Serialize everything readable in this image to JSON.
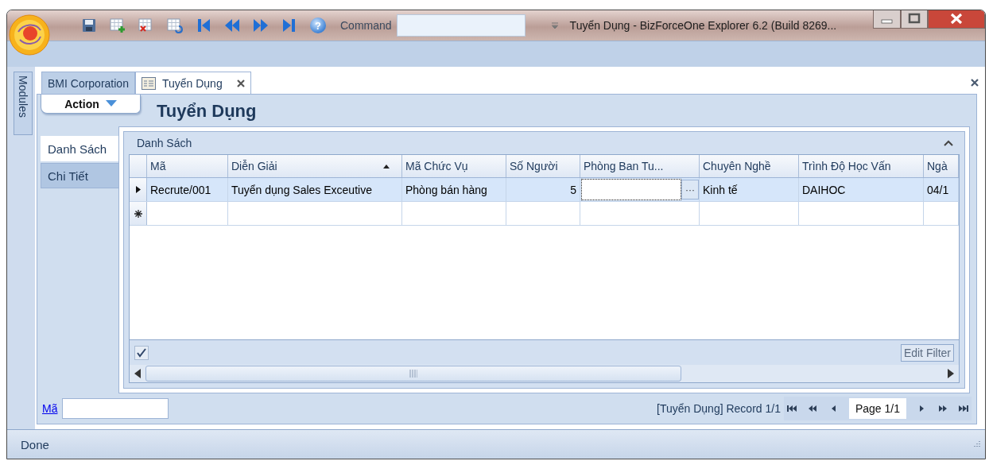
{
  "title_bar": {
    "help": "?",
    "command_label": "Command",
    "title": "Tuyển Dụng - BizForceOne Explorer 6.2 (Build 8269..."
  },
  "side_panel": {
    "label": "Modules"
  },
  "doc_tabs": [
    {
      "label": "BMI Corporation",
      "selected": false,
      "closable": false
    },
    {
      "label": "Tuyển Dụng",
      "selected": true,
      "closable": true
    }
  ],
  "action_menu": {
    "label": "Action"
  },
  "page_title": "Tuyển Dụng",
  "view_tabs": [
    {
      "label": "Danh Sách",
      "selected": true
    },
    {
      "label": "Chi Tiết",
      "selected": false
    }
  ],
  "grid": {
    "title": "Danh Sách",
    "columns": [
      {
        "label": "Mã",
        "sorted_ascending": false
      },
      {
        "label": "Diễn Giải",
        "sorted_ascending": true
      },
      {
        "label": "Mã Chức Vụ",
        "sorted_ascending": false
      },
      {
        "label": "Số Người",
        "sorted_ascending": false
      },
      {
        "label": "Phòng Ban Tu...",
        "sorted_ascending": false
      },
      {
        "label": "Chuyên Nghề",
        "sorted_ascending": false
      },
      {
        "label": "Trình Độ Học Vấn",
        "sorted_ascending": false
      },
      {
        "label": "Ngà",
        "sorted_ascending": false
      }
    ],
    "rows": [
      {
        "kind": "data",
        "current": true,
        "cells": [
          {
            "kind": "text",
            "text": "Recrute/001"
          },
          {
            "kind": "text",
            "text": "Tuyển dụng Sales Exceutive"
          },
          {
            "kind": "text",
            "text": "Phòng bán hàng"
          },
          {
            "kind": "number",
            "text": "5"
          },
          {
            "kind": "editor",
            "button": "···"
          },
          {
            "kind": "text",
            "text": "Kinh tế"
          },
          {
            "kind": "text",
            "text": "DAIHOC"
          },
          {
            "kind": "text",
            "text": "04/1"
          }
        ]
      },
      {
        "kind": "new",
        "current": false
      }
    ],
    "filter": {
      "checked": true,
      "button": "Edit Filter"
    }
  },
  "search": {
    "label": "Mã"
  },
  "pager": {
    "record": "[Tuyển Dụng] Record 1/1",
    "page": "Page 1/1"
  },
  "status_bar": {
    "text": "Done"
  }
}
